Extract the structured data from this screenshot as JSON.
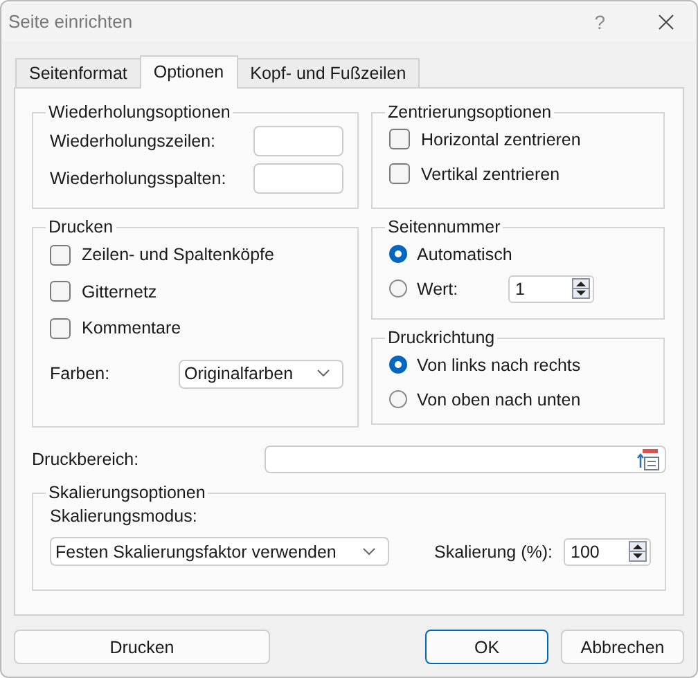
{
  "window": {
    "title": "Seite einrichten",
    "help": "?"
  },
  "tabs": [
    {
      "label": "Seitenformat",
      "selected": false
    },
    {
      "label": "Optionen",
      "selected": true
    },
    {
      "label": "Kopf- und Fußzeilen",
      "selected": false
    }
  ],
  "repeat_options": {
    "title": "Wiederholungsoptionen",
    "rows": [
      {
        "label": "Wiederholungszeilen:"
      },
      {
        "label": "Wiederholungsspalten:"
      }
    ]
  },
  "print": {
    "title": "Drucken",
    "options": [
      {
        "label": "Zeilen- und Spaltenköpfe",
        "checked": false
      },
      {
        "label": "Gitternetz",
        "checked": false
      },
      {
        "label": "Kommentare",
        "checked": false
      }
    ],
    "colors": {
      "label": "Farben:",
      "value": "Originalfarben"
    }
  },
  "centering": {
    "title": "Zentrierungsoptionen",
    "options": [
      {
        "label": "Horizontal zentrieren",
        "checked": false
      },
      {
        "label": "Vertikal zentrieren",
        "checked": false
      }
    ]
  },
  "page_number": {
    "title": "Seitennummer",
    "options": [
      {
        "label": "Automatisch",
        "selected": true
      },
      {
        "label": "Wert:",
        "selected": false
      }
    ],
    "value": "1"
  },
  "print_direction": {
    "title": "Druckrichtung",
    "options": [
      {
        "label": "Von links nach rechts",
        "selected": true
      },
      {
        "label": "Von oben nach unten",
        "selected": false
      }
    ]
  },
  "print_area": {
    "label": "Druckbereich:"
  },
  "scaling": {
    "title": "Skalierungsoptionen",
    "mode_label": "Skalierungsmodus:",
    "mode_value": "Festen Skalierungsfaktor verwenden",
    "factor_label": "Skalierung (%):",
    "factor_value": "100"
  },
  "buttons": [
    {
      "label": "Drucken",
      "kind": "normal"
    },
    {
      "label": "OK",
      "kind": "default"
    },
    {
      "label": "Abbrechen",
      "kind": "normal"
    }
  ]
}
